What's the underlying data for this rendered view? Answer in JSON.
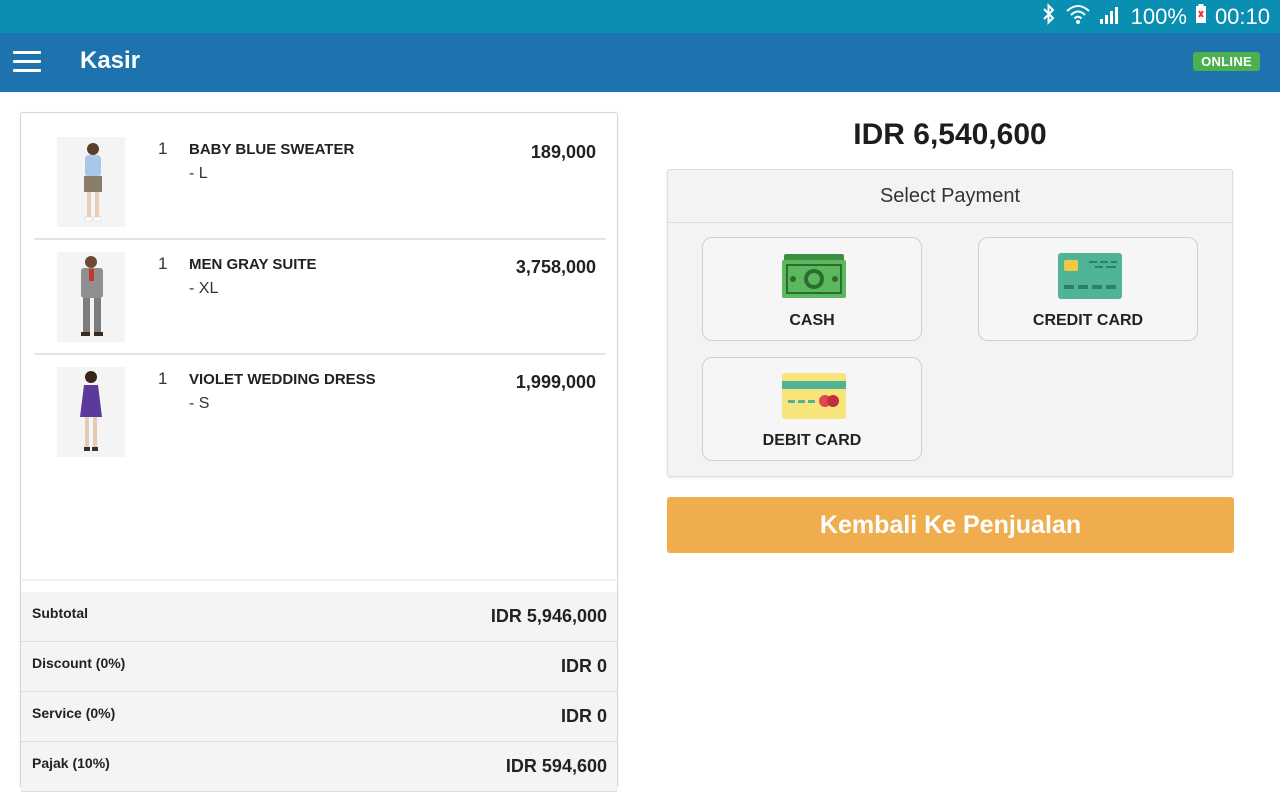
{
  "status_bar": {
    "battery": "100%",
    "time": "00:10",
    "icons": [
      "bluetooth-icon",
      "wifi-icon",
      "signal-icon",
      "battery-icon"
    ]
  },
  "app_bar": {
    "title": "Kasir",
    "status": "ONLINE",
    "menu_icon": "hamburger-menu-icon"
  },
  "cart": {
    "items": [
      {
        "qty": "1",
        "name": "BABY BLUE SWEATER",
        "variant": "- L",
        "price": "189,000"
      },
      {
        "qty": "1",
        "name": "MEN GRAY SUITE",
        "variant": "- XL",
        "price": "3,758,000"
      },
      {
        "qty": "1",
        "name": "VIOLET WEDDING DRESS",
        "variant": "- S",
        "price": "1,999,000"
      }
    ],
    "totals": [
      {
        "label": "Subtotal",
        "value": "IDR 5,946,000"
      },
      {
        "label": "Discount (0%)",
        "value": "IDR 0"
      },
      {
        "label": "Service (0%)",
        "value": "IDR 0"
      },
      {
        "label": "Pajak (10%)",
        "value": "IDR 594,600"
      }
    ]
  },
  "payment": {
    "grand_total": "IDR 6,540,600",
    "header": "Select Payment",
    "options": [
      {
        "label": "CASH",
        "icon": "cash-icon"
      },
      {
        "label": "CREDIT CARD",
        "icon": "credit-card-icon"
      },
      {
        "label": "DEBIT CARD",
        "icon": "debit-card-icon"
      }
    ],
    "back_button": "Kembali Ke Penjualan"
  },
  "colors": {
    "status_bar": "#0a8fb2",
    "app_bar": "#1e72ad",
    "online_badge": "#4caf50",
    "back_button": "#f0ad4e"
  }
}
